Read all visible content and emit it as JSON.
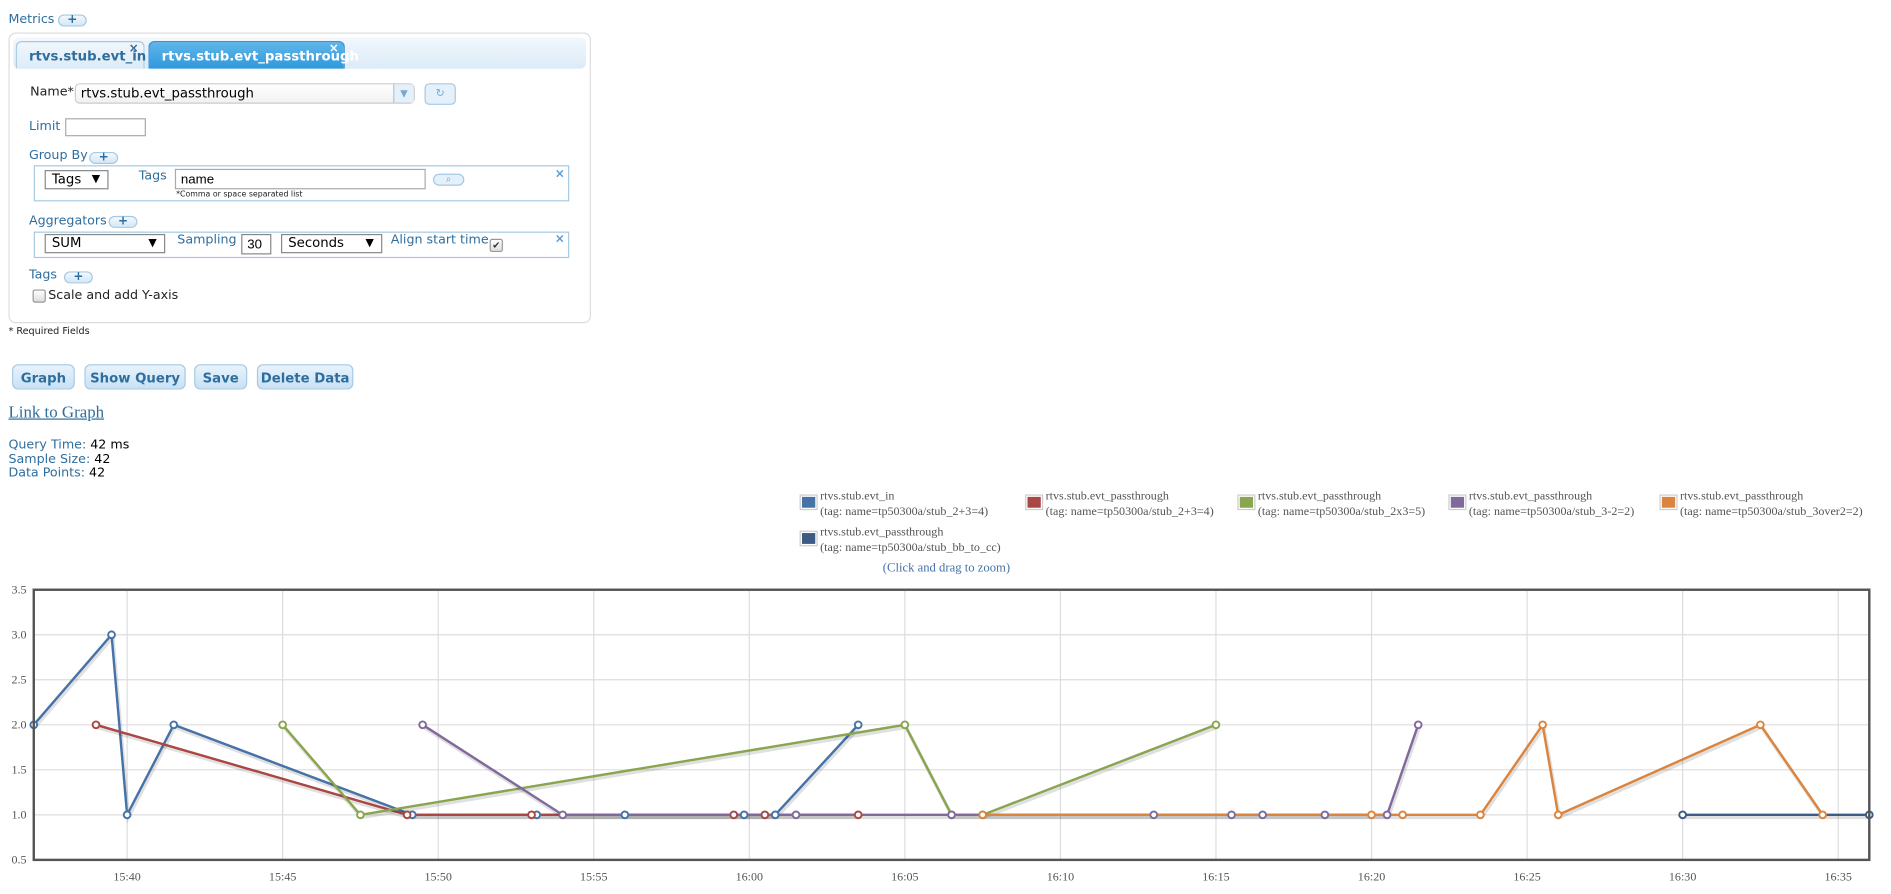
{
  "metrics": {
    "label": "Metrics",
    "add": "+"
  },
  "tabs": [
    {
      "label": "rtvs.stub.evt_in",
      "close": "×",
      "active": false
    },
    {
      "label": "rtvs.stub.evt_passthrough",
      "close": "×",
      "active": true
    }
  ],
  "form": {
    "name_label": "Name*",
    "name_value": "rtvs.stub.evt_passthrough",
    "refresh_icon": "↻",
    "limit_label": "Limit",
    "limit_value": "",
    "group_by_label": "Group By",
    "group_by_type": "Tags",
    "group_tags_label": "Tags",
    "group_tags_value": "name",
    "group_tags_hint": "*Comma or space separated list",
    "aggregators_label": "Aggregators",
    "aggregator": "SUM",
    "sampling_label": "Sampling",
    "sampling_value": "30",
    "sampling_unit": "Seconds",
    "align_label": "Align start time",
    "align_checked": true,
    "tags_label": "Tags",
    "scale_label": "Scale and add Y-axis",
    "scale_checked": false,
    "required": "* Required Fields"
  },
  "buttons": {
    "graph": "Graph",
    "show_query": "Show Query",
    "save": "Save",
    "delete": "Delete Data"
  },
  "link_to_graph": "Link to Graph",
  "stats": {
    "query_time_label": "Query Time:",
    "query_time": "42 ms",
    "sample_size_label": "Sample Size:",
    "sample_size": "42",
    "data_points_label": "Data Points:",
    "data_points": "42"
  },
  "zoom_hint": "(Click and drag to zoom)",
  "chart_data": {
    "type": "line",
    "xlim": [
      "15:37:00",
      "16:36:00"
    ],
    "ylim": [
      0.5,
      3.5
    ],
    "yticks": [
      "0.5",
      "1.0",
      "1.5",
      "2.0",
      "2.5",
      "3.0",
      "3.5"
    ],
    "xticks": [
      "15:40",
      "15:45",
      "15:50",
      "15:55",
      "16:00",
      "16:05",
      "16:10",
      "16:15",
      "16:20",
      "16:25",
      "16:30",
      "16:35"
    ],
    "grid": true,
    "legend": "top",
    "series": [
      {
        "name": "rtvs.stub.evt_in",
        "tag": "(tag: name=tp50300a/stub_2+3=4)",
        "color": "#4572a7",
        "points": [
          [
            "15:37:00",
            2
          ],
          [
            "15:39:30",
            3
          ],
          [
            "15:40:00",
            1
          ],
          [
            "15:41:30",
            2
          ],
          [
            "15:49:10",
            1
          ],
          [
            "15:53:10",
            1
          ],
          [
            "15:56:00",
            1
          ],
          [
            "15:59:50",
            1
          ],
          [
            "16:00:50",
            1
          ],
          [
            "16:03:30",
            2
          ]
        ]
      },
      {
        "name": "rtvs.stub.evt_passthrough",
        "tag": "(tag: name=tp50300a/stub_2+3=4)",
        "color": "#aa4643",
        "points": [
          [
            "15:39:00",
            2
          ],
          [
            "15:49:00",
            1
          ],
          [
            "15:53:00",
            1
          ],
          [
            "15:59:30",
            1
          ],
          [
            "16:00:30",
            1
          ],
          [
            "16:03:30",
            1
          ]
        ]
      },
      {
        "name": "rtvs.stub.evt_passthrough",
        "tag": "(tag: name=tp50300a/stub_2x3=5)",
        "color": "#89a54e",
        "points": [
          [
            "15:45:00",
            2
          ],
          [
            "15:47:30",
            1
          ],
          [
            "16:05:00",
            2
          ],
          [
            "16:06:30",
            1
          ],
          [
            "16:07:30",
            1
          ],
          [
            "16:15:00",
            2
          ]
        ]
      },
      {
        "name": "rtvs.stub.evt_passthrough",
        "tag": "(tag: name=tp50300a/stub_3-2=2)",
        "color": "#80699b",
        "points": [
          [
            "15:49:30",
            2
          ],
          [
            "15:54:00",
            1
          ],
          [
            "16:01:30",
            1
          ],
          [
            "16:06:30",
            1
          ],
          [
            "16:13:00",
            1
          ],
          [
            "16:15:30",
            1
          ],
          [
            "16:16:30",
            1
          ],
          [
            "16:18:30",
            1
          ],
          [
            "16:20:30",
            1
          ],
          [
            "16:21:30",
            2
          ]
        ]
      },
      {
        "name": "rtvs.stub.evt_passthrough",
        "tag": "(tag: name=tp50300a/stub_3over2=2)",
        "color": "#db843d",
        "points": [
          [
            "16:07:30",
            1
          ],
          [
            "16:20:00",
            1
          ],
          [
            "16:21:00",
            1
          ],
          [
            "16:23:30",
            1
          ],
          [
            "16:25:30",
            2
          ],
          [
            "16:26:00",
            1
          ],
          [
            "16:32:30",
            2
          ],
          [
            "16:34:30",
            1
          ]
        ]
      },
      {
        "name": "rtvs.stub.evt_passthrough",
        "tag": "(tag: name=tp50300a/stub_bb_to_cc)",
        "color": "#3d5b85",
        "points": [
          [
            "16:30:00",
            1
          ],
          [
            "16:36:00",
            1
          ]
        ]
      }
    ]
  }
}
